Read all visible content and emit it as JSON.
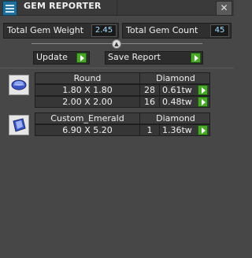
{
  "window": {
    "title": "GEM REPORTER",
    "close_icon": "close-icon"
  },
  "stats": {
    "total_weight_label": "Total Gem Weight",
    "total_weight_value": "2.45",
    "total_count_label": "Total Gem Count",
    "total_count_value": "45"
  },
  "actions": {
    "update_label": "Update",
    "save_report_label": "Save Report"
  },
  "groups": [
    {
      "icon": "round-gem-icon",
      "cut": "Round",
      "material": "Diamond",
      "rows": [
        {
          "size": "1.80 X 1.80",
          "count": "28",
          "weight": "0.61tw"
        },
        {
          "size": "2.00 X 2.00",
          "count": "16",
          "weight": "0.48tw"
        }
      ]
    },
    {
      "icon": "emerald-gem-icon",
      "cut": "Custom_Emerald",
      "material": "Diamond",
      "rows": [
        {
          "size": "6.90 X 5.20",
          "count": "1",
          "weight": "1.36tw"
        }
      ]
    }
  ],
  "colors": {
    "accent_green": "#4aa72a",
    "value_blue": "#9fe0ff",
    "background": "#474747"
  }
}
